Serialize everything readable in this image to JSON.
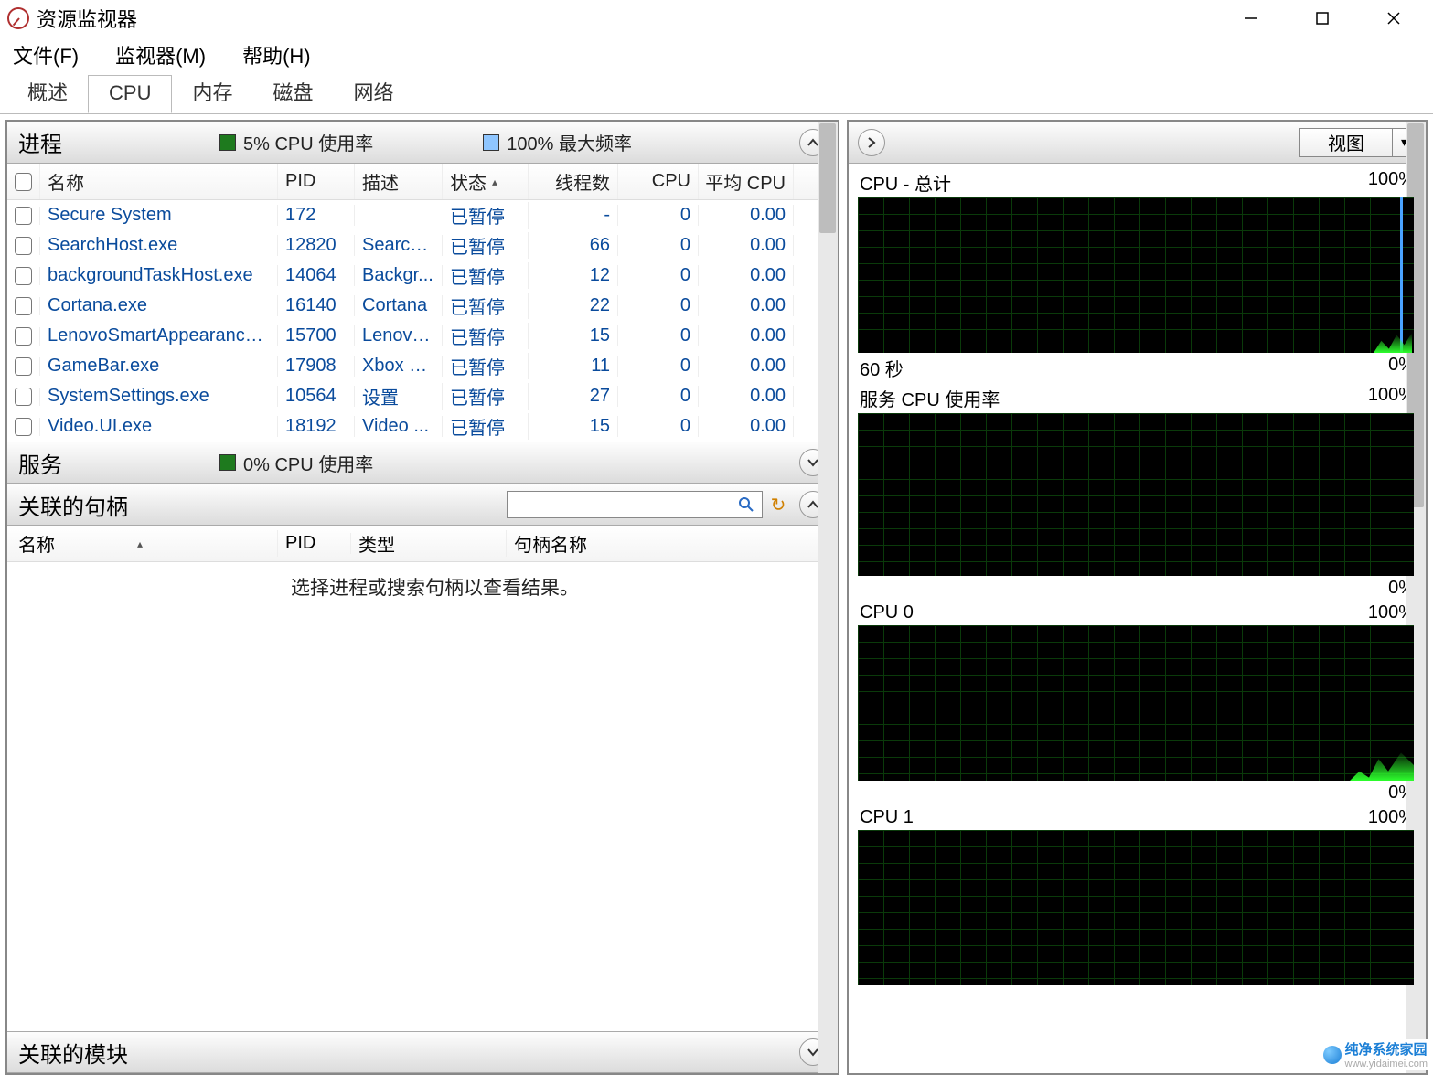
{
  "window": {
    "title": "资源监视器"
  },
  "menu": {
    "file": "文件(F)",
    "monitor": "监视器(M)",
    "help": "帮助(H)"
  },
  "tabs": {
    "overview": "概述",
    "cpu": "CPU",
    "memory": "内存",
    "disk": "磁盘",
    "network": "网络",
    "active": "cpu"
  },
  "processes": {
    "title": "进程",
    "metric1": "5% CPU 使用率",
    "metric2": "100% 最大频率",
    "columns": {
      "name": "名称",
      "pid": "PID",
      "desc": "描述",
      "status": "状态",
      "threads": "线程数",
      "cpu": "CPU",
      "avgcpu": "平均 CPU"
    },
    "rows": [
      {
        "name": "Secure System",
        "pid": "172",
        "desc": "",
        "status": "已暂停",
        "threads": "-",
        "cpu": "0",
        "avg": "0.00"
      },
      {
        "name": "SearchHost.exe",
        "pid": "12820",
        "desc": "Search...",
        "status": "已暂停",
        "threads": "66",
        "cpu": "0",
        "avg": "0.00"
      },
      {
        "name": "backgroundTaskHost.exe",
        "pid": "14064",
        "desc": "Backgr...",
        "status": "已暂停",
        "threads": "12",
        "cpu": "0",
        "avg": "0.00"
      },
      {
        "name": "Cortana.exe",
        "pid": "16140",
        "desc": "Cortana",
        "status": "已暂停",
        "threads": "22",
        "cpu": "0",
        "avg": "0.00"
      },
      {
        "name": "LenovoSmartAppearance.exe",
        "pid": "15700",
        "desc": "Lenovo...",
        "status": "已暂停",
        "threads": "15",
        "cpu": "0",
        "avg": "0.00"
      },
      {
        "name": "GameBar.exe",
        "pid": "17908",
        "desc": "Xbox G...",
        "status": "已暂停",
        "threads": "11",
        "cpu": "0",
        "avg": "0.00"
      },
      {
        "name": "SystemSettings.exe",
        "pid": "10564",
        "desc": "设置",
        "status": "已暂停",
        "threads": "27",
        "cpu": "0",
        "avg": "0.00"
      },
      {
        "name": "Video.UI.exe",
        "pid": "18192",
        "desc": "Video ...",
        "status": "已暂停",
        "threads": "15",
        "cpu": "0",
        "avg": "0.00"
      }
    ]
  },
  "services": {
    "title": "服务",
    "metric": "0% CPU 使用率"
  },
  "handles": {
    "title": "关联的句柄",
    "columns": {
      "name": "名称",
      "pid": "PID",
      "type": "类型",
      "hname": "句柄名称"
    },
    "placeholder": "选择进程或搜索句柄以查看结果。"
  },
  "modules": {
    "title": "关联的模块"
  },
  "rightpane": {
    "viewlabel": "视图",
    "charts": [
      {
        "title": "CPU - 总计",
        "top": "100%",
        "bl": "60 秒",
        "br": "0%"
      },
      {
        "title": "服务 CPU 使用率",
        "top": "100%",
        "bl": "",
        "br": "0%"
      },
      {
        "title": "CPU 0",
        "top": "100%",
        "bl": "",
        "br": "0%"
      },
      {
        "title": "CPU 1",
        "top": "100%",
        "bl": "",
        "br": ""
      }
    ]
  },
  "watermark": {
    "brand": "纯净系统家园",
    "url": "www.yidaimei.com"
  },
  "chart_data": [
    {
      "type": "area",
      "title": "CPU - 总计",
      "ylabel": "%",
      "ylim": [
        0,
        100
      ],
      "x_span_seconds": 60,
      "series": [
        {
          "name": "CPU 使用率",
          "approx_recent_percent": 12
        },
        {
          "name": "最大频率",
          "approx_recent_percent": 100
        }
      ]
    },
    {
      "type": "area",
      "title": "服务 CPU 使用率",
      "ylabel": "%",
      "ylim": [
        0,
        100
      ],
      "x_span_seconds": 60,
      "series": [
        {
          "name": "CPU 使用率",
          "approx_recent_percent": 0
        }
      ]
    },
    {
      "type": "area",
      "title": "CPU 0",
      "ylabel": "%",
      "ylim": [
        0,
        100
      ],
      "x_span_seconds": 60,
      "series": [
        {
          "name": "CPU 使用率",
          "approx_recent_percent": 18
        }
      ]
    },
    {
      "type": "area",
      "title": "CPU 1",
      "ylabel": "%",
      "ylim": [
        0,
        100
      ],
      "x_span_seconds": 60,
      "series": [
        {
          "name": "CPU 使用率",
          "approx_recent_percent": 0
        }
      ]
    }
  ]
}
